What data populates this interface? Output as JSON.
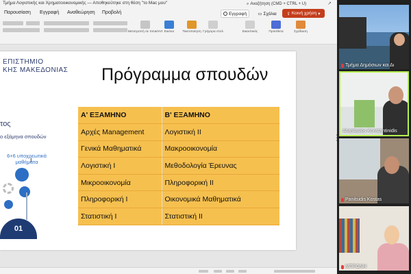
{
  "window": {
    "title": "Τμήμα Λογιστικής και Χρηματοοικονομικής — Αποθηκεύτηκε στη θέση \"το Mac μου\"",
    "search_placeholder": "Αναζήτηση (CMD + CTRL + U)"
  },
  "menu": [
    "Παρουσίαση",
    "Εγγραφή",
    "Αναθεώρηση",
    "Προβολή"
  ],
  "actions": {
    "record_label": "Εγγραφή",
    "comments_label": "Σχόλια",
    "share_label": "Κοινή χρήση"
  },
  "ribbon": {
    "convert_smartart": "Μετατροπή σε SmartArt",
    "image": "Εικόνα",
    "arrange": "Τακτοποίηση",
    "quick_styles": "Γρήγορα στυλ",
    "designer": "Εικαστικός",
    "add_ins": "Πρόσθετα",
    "designer2": "Σχεδίαση"
  },
  "slide": {
    "logo_line1": "ΕΠΙΣΤΗΜΙΟ",
    "logo_line2": "ΚΗΣ ΜΑΚΕΔΟΝΙΑΣ",
    "title": "Πρόγραμμα σπουδών",
    "left_heading": "τος",
    "left_sub": "ο εξάμηνα σπουδών",
    "left_note": "6+6 υποχρεωτικά μαθήματα",
    "cursor_mark": "I",
    "badge": "01",
    "table": {
      "headers": [
        "Α' ΕΞΑΜΗΝΟ",
        "Β' ΕΞΑΜΗΝΟ"
      ],
      "rows": [
        [
          "Αρχές Management",
          "Λογιστική ΙΙ"
        ],
        [
          "Γενικά Μαθηματικά",
          "Μακροοικονομία"
        ],
        [
          "Λογιστική Ι",
          "Μεθοδολογία Έρευνας"
        ],
        [
          "Μικροοικονομία",
          "Πληροφορική ΙΙ"
        ],
        [
          "Πληροφορική Ι",
          "Οικονομικά Μαθηματικά"
        ],
        [
          "Στατιστική Ι",
          "Στατιστική ΙΙ"
        ]
      ]
    }
  },
  "participants": [
    {
      "name": "Τμήμα Δημόσιων και Δι",
      "muted": true
    },
    {
      "name": "Anastasios Konstantinidis",
      "muted": false
    },
    {
      "name": "Panitsidis Kostas",
      "muted": true
    },
    {
      "name": "ΜΠΡΩΝΗ",
      "muted": true
    }
  ],
  "colors": {
    "accent": "#c43e1c",
    "table_fill": "#f6c04f",
    "active_speaker": "#b6f14e",
    "logo_blue": "#2d3b6e"
  }
}
